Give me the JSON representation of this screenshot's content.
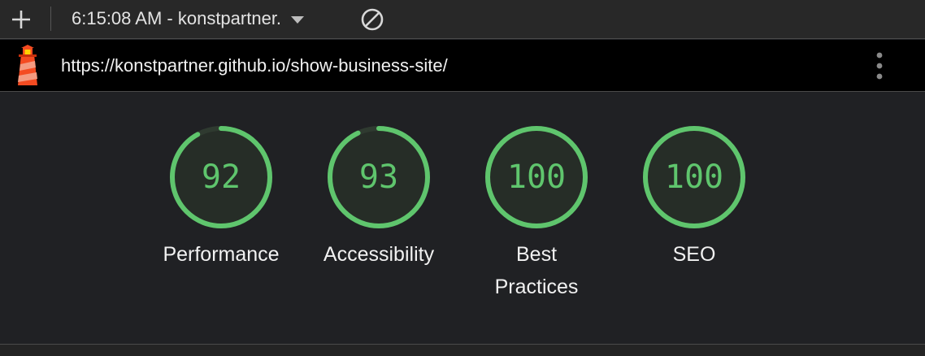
{
  "toolbar": {
    "report_label": "6:15:08 AM - konstpartner.",
    "icons": [
      "plus-icon",
      "chevron-down-icon",
      "clear-icon"
    ]
  },
  "urlbar": {
    "url": "https://konstpartner.github.io/show-business-site/",
    "icons": [
      "lighthouse-icon",
      "more-vertical-icon"
    ]
  },
  "colors": {
    "pass": "#5fc56d",
    "ring_track": "#2f3a30",
    "background": "#202124"
  },
  "gauges": [
    {
      "score": 92,
      "label": "Performance"
    },
    {
      "score": 93,
      "label": "Accessibility"
    },
    {
      "score": 100,
      "label_line1": "Best",
      "label_line2": "Practices"
    },
    {
      "score": 100,
      "label": "SEO"
    }
  ]
}
